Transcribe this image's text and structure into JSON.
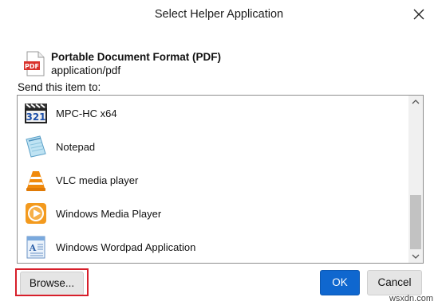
{
  "window": {
    "title": "Select Helper Application"
  },
  "file_type": {
    "name": "Portable Document Format (PDF)",
    "mime": "application/pdf",
    "icon": "pdf-file-icon"
  },
  "list": {
    "label": "Send this item to:",
    "items": [
      {
        "label": "MPC-HC x64",
        "icon": "mpc-hc-icon"
      },
      {
        "label": "Notepad",
        "icon": "notepad-icon"
      },
      {
        "label": "VLC media player",
        "icon": "vlc-icon"
      },
      {
        "label": "Windows Media Player",
        "icon": "windows-media-player-icon"
      },
      {
        "label": "Windows Wordpad Application",
        "icon": "wordpad-icon"
      }
    ]
  },
  "buttons": {
    "browse": "Browse...",
    "ok": "OK",
    "cancel": "Cancel"
  },
  "watermark": "wsxdn.com",
  "colors": {
    "accent": "#0f67cf",
    "highlight": "#d71f2b"
  }
}
